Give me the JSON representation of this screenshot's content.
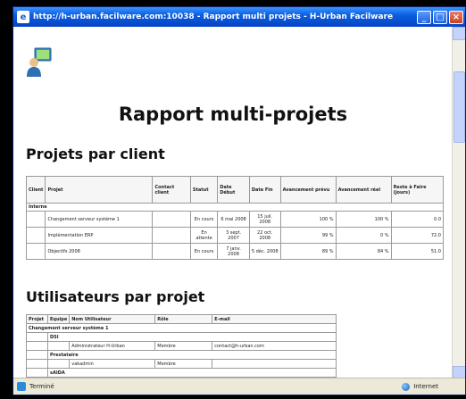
{
  "window": {
    "title": "http://h-urban.facilware.com:10038 - Rapport multi projets - H-Urban Facilware",
    "minimize": "_",
    "maximize": "□",
    "close": "×"
  },
  "report": {
    "title": "Rapport multi-projets"
  },
  "section_client": {
    "heading": "Projets par client",
    "headers": [
      "Client",
      "Projet",
      "Contact client",
      "Statut",
      "Date Début",
      "Date Fin",
      "Avancement prévu",
      "Avancement réel",
      "Reste à Faire (jours)"
    ],
    "group": "Interne",
    "rows": [
      {
        "projet": "Changement serveur système 1",
        "contact": "",
        "statut": "En cours",
        "debut": "6 mai 2008",
        "fin": "15 juil. 2008",
        "prevu": "100 %",
        "reel": "100 %",
        "raf": "0.0"
      },
      {
        "projet": "Implémentation ERP",
        "contact": "",
        "statut": "En attente",
        "debut": "3 sept. 2007",
        "fin": "22 oct. 2008",
        "prevu": "99 %",
        "reel": "0 %",
        "raf": "72.0"
      },
      {
        "projet": "Objectifs 2008",
        "contact": "",
        "statut": "En cours",
        "debut": "7 janv. 2008",
        "fin": "5 déc. 2008",
        "prevu": "89 %",
        "reel": "84 %",
        "raf": "51.0"
      }
    ]
  },
  "section_users": {
    "heading": "Utilisateurs par projet",
    "headers": [
      "Projet",
      "Equipe",
      "Nom Utilisateur",
      "Rôle",
      "E-mail"
    ],
    "project_group": "Changement serveur système 1",
    "team1": "DSI",
    "user1": {
      "name": "Administrateur H-Urban",
      "role": "Membre",
      "email": "contact@h-urban.com"
    },
    "team2": "Prestataire",
    "user2": {
      "name": "vakadmin",
      "role": "Membre",
      "email": ""
    },
    "team3": "sAIDA"
  },
  "statusbar": {
    "left": "Terminé",
    "zone": "Internet"
  }
}
